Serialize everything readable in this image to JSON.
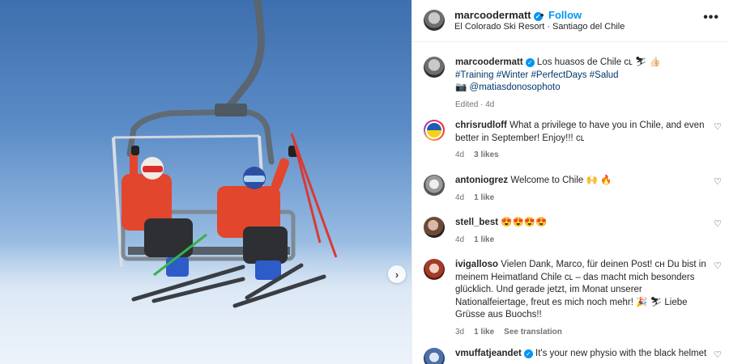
{
  "post": {
    "username": "marcoodermatt",
    "follow_label": "Follow",
    "dot": "•",
    "location": "El Colorado Ski Resort · Santiago del Chile",
    "more_label": "•••",
    "next_label": "›"
  },
  "caption": {
    "username": "marcoodermatt",
    "text": "Los huasos de Chile ᴄʟ ⛷ 👍🏻",
    "hashtags": "#Training #Winter #PerfectDays #Salud",
    "camera": "📷",
    "photo_credit": "@matiasdonosophoto",
    "edited": "Edited · 4d"
  },
  "comments": [
    {
      "username": "chrisrudloff",
      "text": "What a privilege to have you in Chile, and even better in September! Enjoy!!! ᴄʟ",
      "time": "4d",
      "likes": "3 likes",
      "extra": ""
    },
    {
      "username": "antoniogrez",
      "text": "Welcome to Chile 🙌 🔥",
      "time": "4d",
      "likes": "1 like",
      "extra": ""
    },
    {
      "username": "stell_best",
      "text": "😍😍😍😍",
      "time": "4d",
      "likes": "1 like",
      "extra": ""
    },
    {
      "username": "ivigalloso",
      "text": "Vielen Dank, Marco, für deinen Post! ᴄʜ Du bist in meinem Heimatland Chile ᴄʟ – das macht mich besonders glücklich. Und gerade jetzt, im Monat unserer Nationalfeiertage, freut es mich noch mehr! 🎉 ⛷ Liebe Grüsse aus Buochs!!",
      "time": "3d",
      "likes": "1 like",
      "extra": "See translation"
    },
    {
      "username": "vmuffatjeandet",
      "text": "It's your new physio with the black helmet",
      "time": "",
      "likes": "",
      "extra": ""
    }
  ],
  "heart_icon": "♡",
  "verified_mark": "✓",
  "colors": {
    "accent": "#0095f6",
    "hashtag": "#00376b",
    "muted": "#737373"
  }
}
